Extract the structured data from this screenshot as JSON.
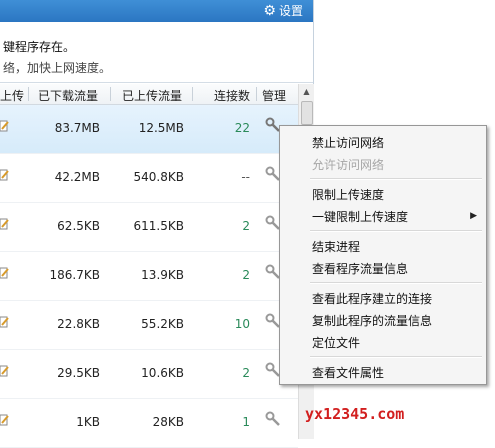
{
  "header": {
    "settings_label": "设置",
    "settings_icon": "gear-icon"
  },
  "info": {
    "line1": "键程序存在。",
    "line2": "络，加快上网速度。"
  },
  "table": {
    "columns": {
      "upload_partial": "上传",
      "downloaded": "已下载流量",
      "uploaded": "已上传流量",
      "connections": "连接数",
      "manage": "管理"
    },
    "rows": [
      {
        "downloaded": "83.7MB",
        "uploaded": "12.5MB",
        "connections": "22"
      },
      {
        "downloaded": "42.2MB",
        "uploaded": "540.8KB",
        "connections": "--"
      },
      {
        "downloaded": "62.5KB",
        "uploaded": "611.5KB",
        "connections": "2"
      },
      {
        "downloaded": "186.7KB",
        "uploaded": "13.9KB",
        "connections": "2"
      },
      {
        "downloaded": "22.8KB",
        "uploaded": "55.2KB",
        "connections": "10"
      },
      {
        "downloaded": "29.5KB",
        "uploaded": "10.6KB",
        "connections": "2"
      },
      {
        "downloaded": "1KB",
        "uploaded": "28KB",
        "connections": "1"
      }
    ]
  },
  "context_menu": {
    "ban_network": "禁止访问网络",
    "allow_network": "允许访问网络",
    "limit_upload": "限制上传速度",
    "one_click_limit": "一键限制上传速度",
    "end_process": "结束进程",
    "view_traffic": "查看程序流量信息",
    "view_connections": "查看此程序建立的连接",
    "copy_traffic": "复制此程序的流量信息",
    "locate_file": "定位文件",
    "file_properties": "查看文件属性"
  },
  "watermark": "yx12345.com",
  "colors": {
    "titlebar": "#2b76c2",
    "selected_row": "#d6ebfa",
    "connections_text": "#2a8a5a",
    "watermark": "#d21f1f"
  }
}
